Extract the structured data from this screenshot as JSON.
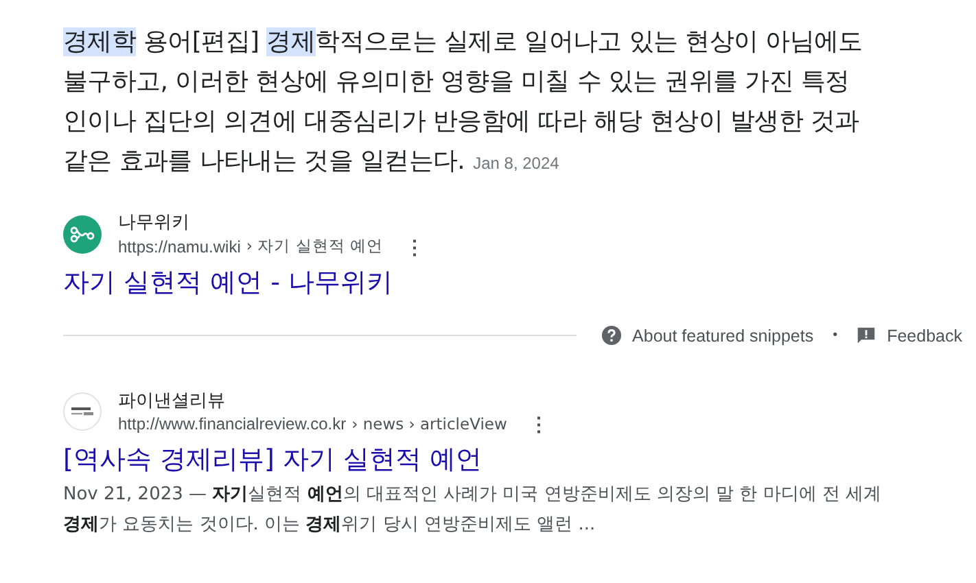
{
  "featured_snippet": {
    "lines": [
      [
        {
          "text": "경제학",
          "highlighted": true
        },
        {
          "text": " 용어[편집] ",
          "highlighted": false
        },
        {
          "text": "경제",
          "highlighted": true
        },
        {
          "text": "학적으로는 실제로 일어나고 있는 현상이 아님에도",
          "highlighted": false
        }
      ],
      [
        {
          "text": "불구하고, 이러한 현상에 유의미한 영향을 미칠 수 있는 권위를 가진 특정",
          "highlighted": false
        }
      ],
      [
        {
          "text": "인이나 집단의 의견에 대중심리가 반응함에 따라 해당 현상이 발생한 것과",
          "highlighted": false
        }
      ],
      [
        {
          "text": "같은 효과를 나타내는 것을 일컫는다.",
          "highlighted": false
        }
      ]
    ],
    "date": "Jan 8, 2024",
    "source": {
      "name": "나무위키",
      "url": "https://namu.wiki",
      "path": "› 자기 실현적 예언",
      "menu": "⋮"
    },
    "title": "자기 실현적 예언 - 나무위키",
    "footer": {
      "about": "About featured snippets",
      "separator": "•",
      "feedback": "Feedback"
    }
  },
  "results": [
    {
      "source": {
        "name": "파이낸셜리뷰",
        "url": "http://www.financialreview.co.kr",
        "path": "› news › articleView",
        "menu": "⋮"
      },
      "title": "[역사속 경제리뷰] 자기 실현적 예언",
      "snippet": "Nov 21, 2023 — **자기**실현적 **예언**의 대표적인 사례가 미국 연방준비제도 의장의 말 한 마디에 전 세계 **경제**가 요동치는 것이다. 이는 **경제**위기 당시 연방준비제도 앨런 ..."
    }
  ]
}
